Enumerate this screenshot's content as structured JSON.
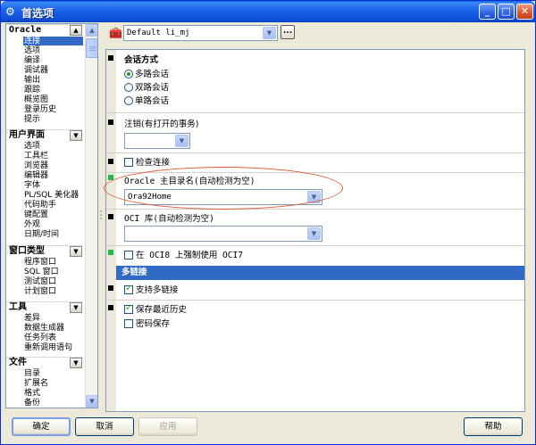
{
  "window": {
    "title": "首选项",
    "app_icon": "gear-wrench-icon",
    "controls": [
      "minimize-icon",
      "maximize-icon",
      "close-icon"
    ]
  },
  "tree": {
    "groups": [
      {
        "title": "Oracle",
        "items": [
          "连接",
          "选项",
          "编译",
          "调试器",
          "输出",
          "跟踪",
          "概览图",
          "登录历史",
          "提示"
        ],
        "selected_index": 0
      },
      {
        "title": "用户界面",
        "items": [
          "选项",
          "工具栏",
          "浏览器",
          "编辑器",
          "字体",
          "PL/SQL 美化器",
          "代码助手",
          "键配置",
          "外观",
          "日期/时间"
        ]
      },
      {
        "title": "窗口类型",
        "items": [
          "程序窗口",
          "SQL 窗口",
          "测试窗口",
          "计划窗口"
        ]
      },
      {
        "title": "工具",
        "items": [
          "差异",
          "数据生成器",
          "任务列表",
          "重新调用语句"
        ]
      },
      {
        "title": "文件",
        "items": [
          "目录",
          "扩展名",
          "格式",
          "备份"
        ]
      }
    ]
  },
  "profile": {
    "value": "Default li_mj",
    "button_label": "..."
  },
  "settings": {
    "session_mode": {
      "label": "会话方式",
      "options": [
        "多路会话",
        "双路会话",
        "单路会话"
      ],
      "selected_index": 0
    },
    "logoff": {
      "label": "注销(有打开的事务)",
      "value": ""
    },
    "check_connection": {
      "label": "检查连接",
      "checked": false
    },
    "oracle_home": {
      "label": "Oracle 主目录名(自动检测为空)",
      "value": "Ora92Home"
    },
    "oci_library": {
      "label": "OCI 库(自动检测为空)",
      "value": ""
    },
    "force_oci7": {
      "label": "在 OCI8 上强制使用 OCI7",
      "checked": false
    },
    "multi_connection": {
      "header": "多链接",
      "support_label": "支持多链接",
      "support_checked": true,
      "history_label": "保存最近历史",
      "history_checked": true,
      "password_label": "密码保存",
      "password_checked": false
    }
  },
  "buttons": {
    "ok": "确定",
    "cancel": "取消",
    "apply": "应用",
    "help": "帮助"
  },
  "colors": {
    "selection": "#316ac5",
    "annotation": "#e05a3a",
    "marker_changed": "#22b84a"
  }
}
